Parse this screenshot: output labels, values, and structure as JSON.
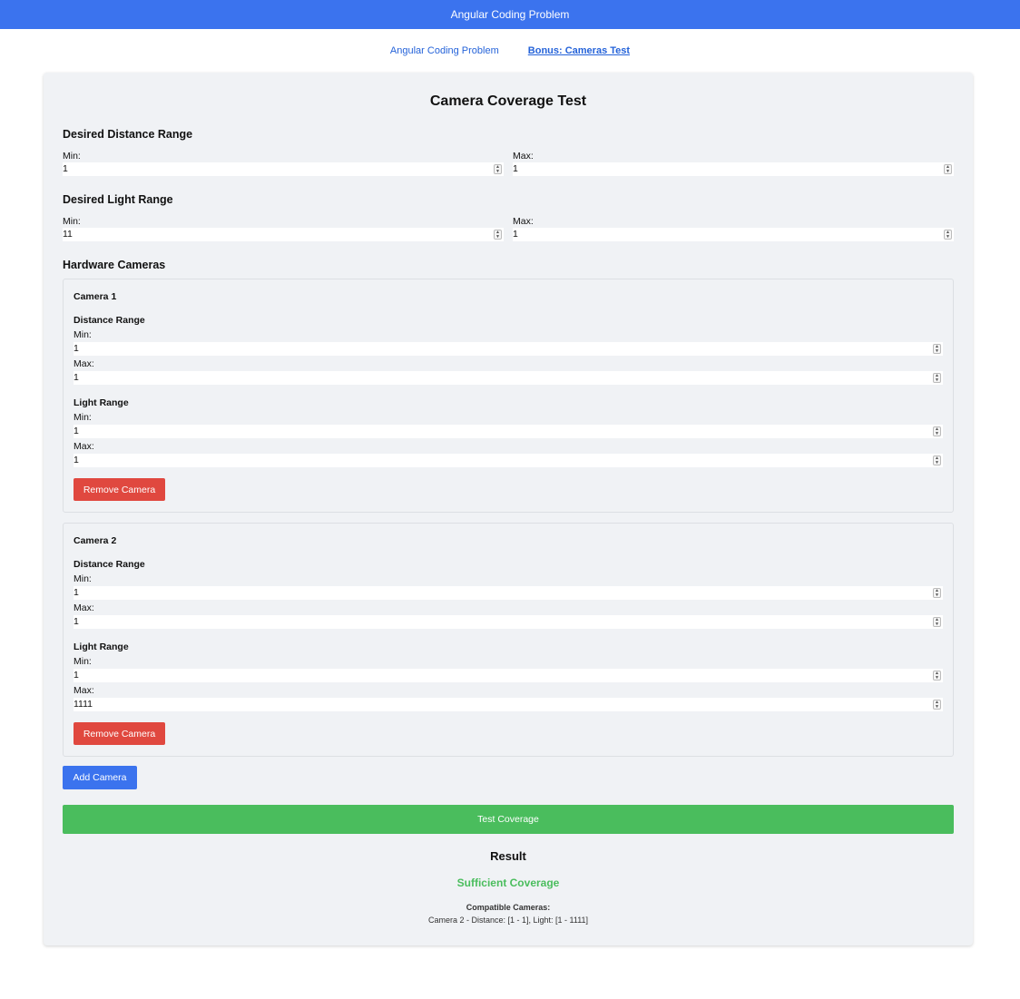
{
  "topbar": {
    "title": "Angular Coding Problem"
  },
  "nav": {
    "link1": "Angular Coding Problem",
    "link2": "Bonus: Cameras Test"
  },
  "page": {
    "title": "Camera Coverage Test"
  },
  "desired_distance": {
    "heading": "Desired Distance Range",
    "min_label": "Min:",
    "max_label": "Max:",
    "min": "1",
    "max": "1"
  },
  "desired_light": {
    "heading": "Desired Light Range",
    "min_label": "Min:",
    "max_label": "Max:",
    "min": "11",
    "max": "1"
  },
  "cameras_heading": "Hardware Cameras",
  "cameras": [
    {
      "title": "Camera 1",
      "distance_heading": "Distance Range",
      "distance_min_label": "Min:",
      "distance_min": "1",
      "distance_max_label": "Max:",
      "distance_max": "1",
      "light_heading": "Light Range",
      "light_min_label": "Min:",
      "light_min": "1",
      "light_max_label": "Max:",
      "light_max": "1",
      "remove_label": "Remove Camera"
    },
    {
      "title": "Camera 2",
      "distance_heading": "Distance Range",
      "distance_min_label": "Min:",
      "distance_min": "1",
      "distance_max_label": "Max:",
      "distance_max": "1",
      "light_heading": "Light Range",
      "light_min_label": "Min:",
      "light_min": "1",
      "light_max_label": "Max:",
      "light_max": "1111",
      "remove_label": "Remove Camera"
    }
  ],
  "add_camera_label": "Add Camera",
  "test_coverage_label": "Test Coverage",
  "result": {
    "heading": "Result",
    "status": "Sufficient Coverage",
    "compatible_label": "Compatible Cameras:",
    "compatible_list": [
      "Camera 2 - Distance: [1 - 1], Light: [1 - 1111]"
    ]
  },
  "colors": {
    "primary": "#3b73ee",
    "danger": "#e0483f",
    "success": "#4abd5d",
    "panel_bg": "#f0f2f5"
  }
}
